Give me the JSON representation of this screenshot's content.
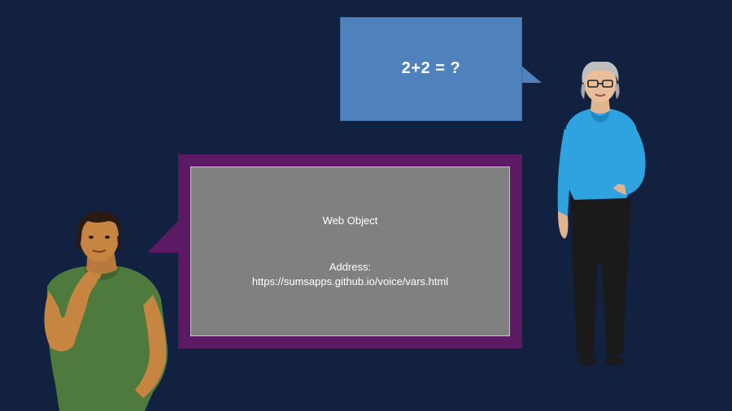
{
  "question_bubble": {
    "text": "2+2 = ?"
  },
  "web_object": {
    "title": "Web Object",
    "address_label": "Address:",
    "address": "https://sumsapps.github.io/voice/vars.html"
  },
  "colors": {
    "background": "#11213f",
    "question_bubble": "#4f81bd",
    "web_frame": "#5b1a63",
    "web_object": "#808080"
  }
}
